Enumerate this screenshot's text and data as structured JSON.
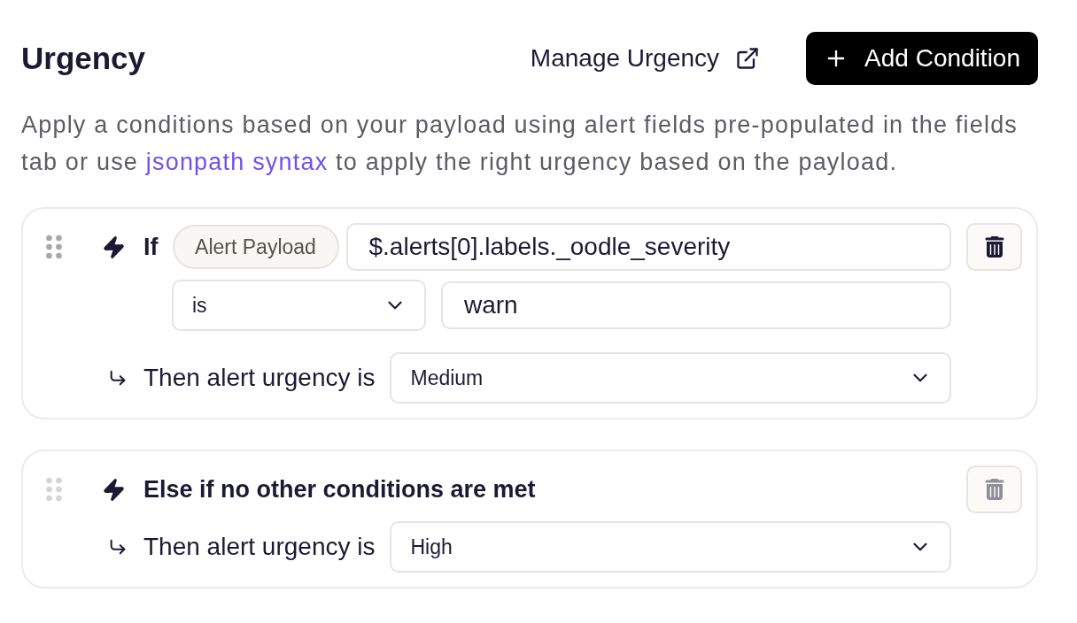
{
  "header": {
    "title": "Urgency",
    "manage_link": "Manage Urgency",
    "add_button": "Add Condition"
  },
  "description": {
    "before": "Apply a conditions based on your payload using alert fields pre-populated in the fields tab or use",
    "link": "jsonpath syntax",
    "after": "to apply the right urgency based on the payload."
  },
  "rules": [
    {
      "kind": "condition",
      "keyword": "If",
      "source": "Alert Payload",
      "path": "$.alerts[0].labels._oodle_severity",
      "operator": "is",
      "value": "warn",
      "then_label": "Then alert urgency is",
      "urgency": "Medium",
      "disabled": false
    },
    {
      "kind": "fallback",
      "title": "Else if no other conditions are met",
      "then_label": "Then alert urgency is",
      "urgency": "High",
      "disabled": true
    }
  ]
}
